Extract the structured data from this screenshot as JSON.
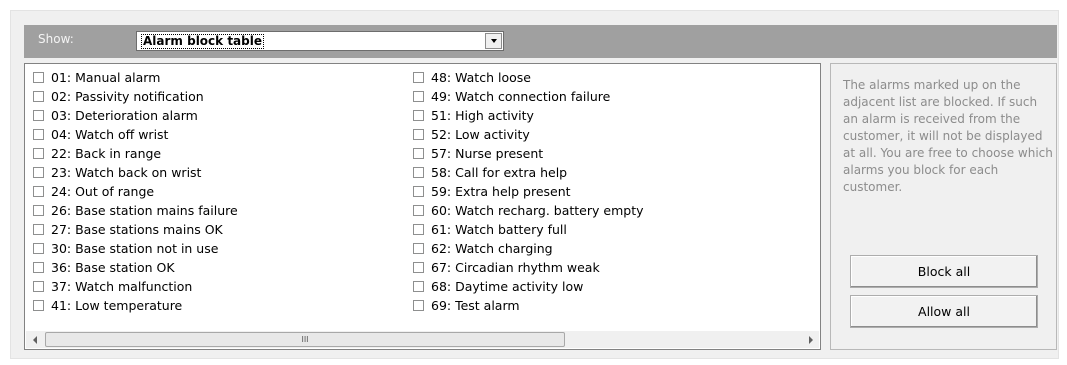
{
  "show": {
    "label": "Show:",
    "selected": "Alarm block table"
  },
  "alarms": {
    "column1": [
      {
        "label": "01: Manual alarm",
        "checked": false
      },
      {
        "label": "02: Passivity notification",
        "checked": false
      },
      {
        "label": "03: Deterioration alarm",
        "checked": false
      },
      {
        "label": "04: Watch off wrist",
        "checked": false
      },
      {
        "label": "22: Back in range",
        "checked": false
      },
      {
        "label": "23: Watch back on wrist",
        "checked": false
      },
      {
        "label": "24: Out of range",
        "checked": false
      },
      {
        "label": "26: Base station mains failure",
        "checked": false
      },
      {
        "label": "27: Base stations mains OK",
        "checked": false
      },
      {
        "label": "30: Base station not in use",
        "checked": false
      },
      {
        "label": "36: Base station OK",
        "checked": false
      },
      {
        "label": "37: Watch malfunction",
        "checked": false
      },
      {
        "label": "41: Low temperature",
        "checked": false
      }
    ],
    "column2": [
      {
        "label": "48: Watch loose",
        "checked": false
      },
      {
        "label": "49: Watch connection failure",
        "checked": false
      },
      {
        "label": "51: High activity",
        "checked": false
      },
      {
        "label": "52: Low activity",
        "checked": false
      },
      {
        "label": "57: Nurse present",
        "checked": false
      },
      {
        "label": "58: Call for extra help",
        "checked": false
      },
      {
        "label": "59: Extra help present",
        "checked": false
      },
      {
        "label": "60: Watch recharg. battery empty",
        "checked": false
      },
      {
        "label": "61: Watch battery full",
        "checked": false
      },
      {
        "label": "62: Watch charging",
        "checked": false
      },
      {
        "label": "67: Circadian rhythm weak",
        "checked": false
      },
      {
        "label": "68: Daytime activity low",
        "checked": false
      },
      {
        "label": "69: Test alarm",
        "checked": false
      }
    ]
  },
  "scrollbar": {
    "thumb_grip": "III",
    "position": 0
  },
  "info": {
    "text": "The alarms marked up on the adjacent list are blocked. If such an alarm is received from the customer, it will not be displayed at all. You are free to choose which alarms you block for each customer."
  },
  "buttons": {
    "block_all": "Block all",
    "allow_all": "Allow all"
  }
}
